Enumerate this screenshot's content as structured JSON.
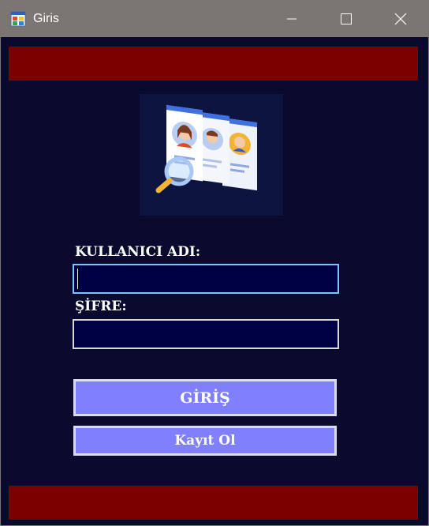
{
  "window": {
    "title": "Giris"
  },
  "form": {
    "username_label": "KULLANICI ADI:",
    "username_value": "",
    "password_label": "ŞİFRE:",
    "password_value": ""
  },
  "buttons": {
    "login": "GİRİŞ",
    "register": "Kayıt Ol"
  },
  "colors": {
    "background": "#0a0a2e",
    "banner": "#7d0000",
    "button": "#8080ff",
    "field": "#000045"
  }
}
